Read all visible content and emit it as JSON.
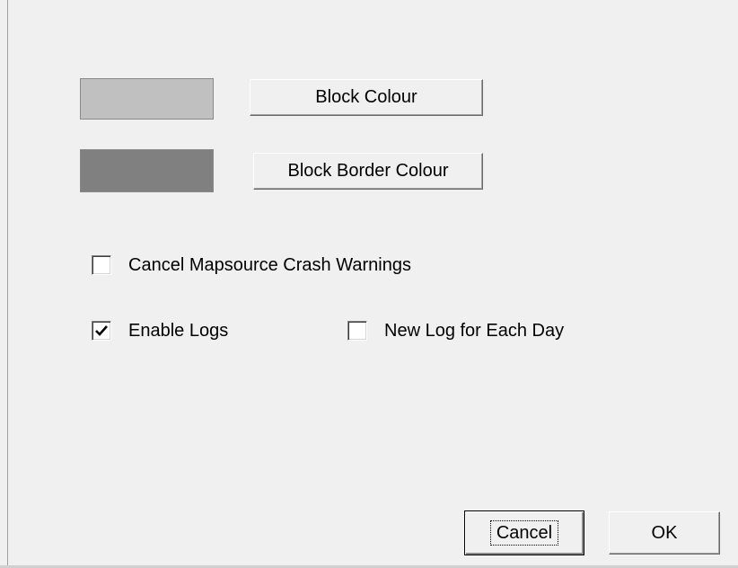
{
  "colors": {
    "block_colour_swatch": "#c0c0c0",
    "block_border_colour_swatch": "#808080"
  },
  "buttons": {
    "block_colour": "Block Colour",
    "block_border_colour": "Block Border Colour",
    "cancel": "Cancel",
    "ok": "OK"
  },
  "options": {
    "cancel_mapsource_crash_warnings": {
      "label": "Cancel Mapsource Crash Warnings",
      "checked": false
    },
    "enable_logs": {
      "label": "Enable Logs",
      "checked": true
    },
    "new_log_for_each_day": {
      "label": "New Log for Each Day",
      "checked": false
    }
  },
  "icons": {
    "checkmark": "checkmark-icon"
  }
}
